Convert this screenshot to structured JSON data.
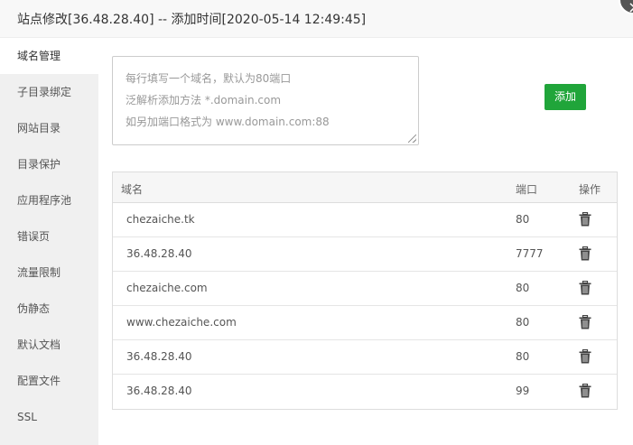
{
  "dialog": {
    "title": "站点修改[36.48.28.40] -- 添加时间[2020-05-14 12:49:45]",
    "close_glyph": "×"
  },
  "sidebar": {
    "items": [
      {
        "label": "域名管理"
      },
      {
        "label": "子目录绑定"
      },
      {
        "label": "网站目录"
      },
      {
        "label": "目录保护"
      },
      {
        "label": "应用程序池"
      },
      {
        "label": "错误页"
      },
      {
        "label": "流量限制"
      },
      {
        "label": "伪静态"
      },
      {
        "label": "默认文档"
      },
      {
        "label": "配置文件"
      },
      {
        "label": "SSL"
      }
    ],
    "active_index": 0
  },
  "domain_input": {
    "placeholder_lines": [
      "每行填写一个域名，默认为80端口",
      "泛解析添加方法 *.domain.com",
      "如另加端口格式为 www.domain.com:88"
    ],
    "value": ""
  },
  "add_button": {
    "label": "添加",
    "color": "#20a53a"
  },
  "table": {
    "headers": {
      "domain": "域名",
      "port": "端口",
      "action": "操作"
    },
    "rows": [
      {
        "domain": "chezaiche.tk",
        "port": "80",
        "action_icon": "trash-icon"
      },
      {
        "domain": "36.48.28.40",
        "port": "7777",
        "action_icon": "trash-icon"
      },
      {
        "domain": "chezaiche.com",
        "port": "80",
        "action_icon": "trash-icon"
      },
      {
        "domain": "www.chezaiche.com",
        "port": "80",
        "action_icon": "trash-icon"
      },
      {
        "domain": "36.48.28.40",
        "port": "80",
        "action_icon": "trash-icon"
      },
      {
        "domain": "36.48.28.40",
        "port": "99",
        "action_icon": "trash-icon"
      }
    ]
  }
}
